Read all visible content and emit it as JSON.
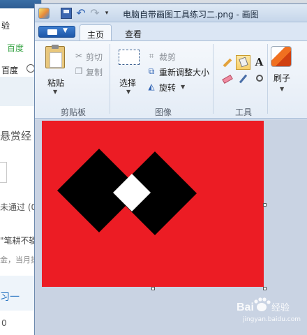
{
  "background_window": {
    "row1": "验",
    "row2": "百度",
    "row3": "百度",
    "row4": "悬赏经",
    "row5": "未通过 (0",
    "row6": "\"笔耕不辍",
    "row7": "金，当月摸",
    "row8": "习一",
    "row9": "0",
    "link_color": "#1f6fbf"
  },
  "title_bar": {
    "title": "电脑自带画图工具练习二.png - 画图",
    "quick_access": [
      "save-icon",
      "undo-icon",
      "redo-icon",
      "customize-icon"
    ]
  },
  "tabs": [
    {
      "label": "主页",
      "active": true
    },
    {
      "label": "查看",
      "active": false
    }
  ],
  "ribbon": {
    "clipboard": {
      "group_label": "剪贴板",
      "paste_label": "粘贴",
      "cut_label": "剪切",
      "copy_label": "复制"
    },
    "image": {
      "group_label": "图像",
      "select_label": "选择",
      "crop_label": "裁剪",
      "resize_label": "重新调整大小",
      "rotate_label": "旋转"
    },
    "tools": {
      "group_label": "工具",
      "items": [
        "pencil-icon",
        "fill-icon",
        "text-icon",
        "eraser-icon",
        "color-picker-icon",
        "magnifier-icon"
      ],
      "text_glyph": "A",
      "active_tool": "fill-icon"
    },
    "brushes": {
      "label": "刷子"
    }
  },
  "canvas": {
    "background_color": "#ec1c24",
    "shape_color": "#000000",
    "inner_color": "#ffffff"
  },
  "watermark": {
    "logo": "Bai 经验",
    "url": "jingyan.baidu.com"
  }
}
